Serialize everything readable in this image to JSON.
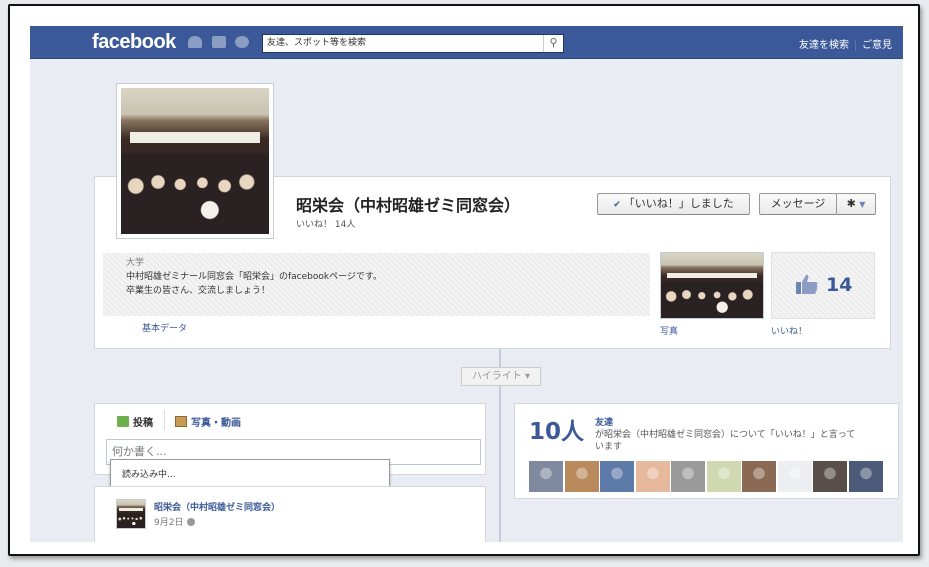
{
  "topbar": {
    "logo": "facebook",
    "search_placeholder": "友達、スポット等を検索",
    "links": [
      "友達を検索",
      "ご意見"
    ]
  },
  "page": {
    "name": "昭栄会（中村昭雄ゼミ同窓会）",
    "likes_line": "いいね！ 14人",
    "category": "大学",
    "about_line1": "中村昭雄ゼミナール同窓会「昭栄会」のfacebookページです。",
    "about_line2": "卒業生の皆さん、交流しましょう！",
    "basic_data": "基本データ"
  },
  "actions": {
    "liked": "「いいね！」しました",
    "message": "メッセージ",
    "gear": "✱"
  },
  "boxes": {
    "photos_label": "写真",
    "likes_count": "14",
    "likes_label": "いいね！"
  },
  "timeline": {
    "highlight": "ハイライト ▾"
  },
  "composer": {
    "tab_post": "投稿",
    "tab_photo": "写真・動画",
    "placeholder": "何か書く...",
    "loading": "読み込み中..."
  },
  "post": {
    "author": "昭栄会（中村昭雄ゼミ同窓会）",
    "date": "9月2日"
  },
  "friends": {
    "count": "10人",
    "title": "友達",
    "desc_line1": "が昭栄会（中村昭雄ゼミ同窓会）について「いいね！」と言って",
    "desc_line2": "います",
    "avatar_colors": [
      "#7f8aa0",
      "#b98a5c",
      "#5d7aa8",
      "#e6b89c",
      "#9a9a9a",
      "#cfd8b0",
      "#8a6a55",
      "#eceef2",
      "#5a4e4a",
      "#4a5a78"
    ]
  }
}
